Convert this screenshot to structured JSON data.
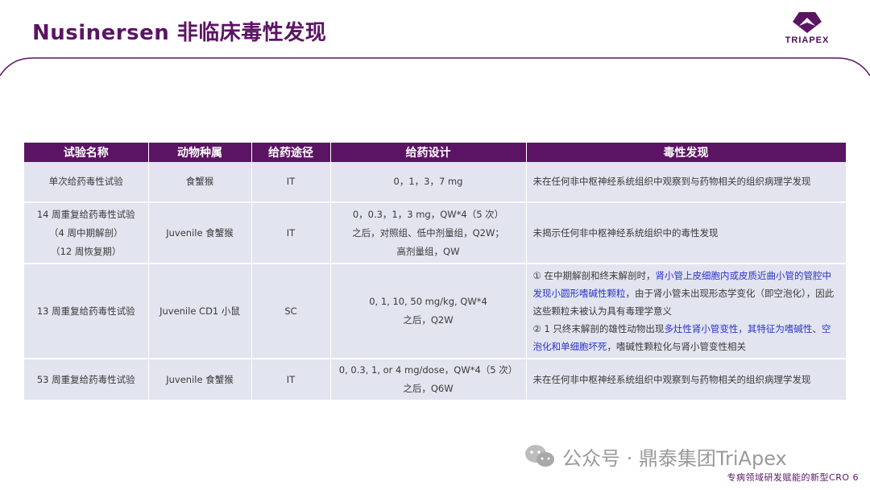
{
  "header": {
    "title": "Nusinersen 非临床毒性发现",
    "logo_text": "TRIAPEX"
  },
  "table": {
    "headers": [
      "试验名称",
      "动物种属",
      "给药途径",
      "给药设计",
      "毒性发现"
    ],
    "rows": [
      {
        "study": [
          "单次给药毒性试验"
        ],
        "species": "食蟹猴",
        "route": "IT",
        "design": [
          "0，1，3，7 mg"
        ],
        "finding": [
          {
            "t": "未在任何非中枢神经系统组织中观察到与药物相关的组织病理学发现"
          }
        ]
      },
      {
        "study": [
          "14 周重复给药毒性试验",
          "（4 周中期解剖）",
          "（12 周恢复期）"
        ],
        "species": "Juvenile 食蟹猴",
        "route": "IT",
        "design": [
          "0，0.3，1，3 mg，QW*4（5 次）",
          "之后，对照组、低中剂量组，Q2W；",
          "高剂量组，QW"
        ],
        "finding": [
          {
            "t": "未揭示任何非中枢神经系统组织中的毒性发现"
          }
        ]
      },
      {
        "study": [
          "13 周重复给药毒性试验"
        ],
        "species": "Juvenile CD1 小鼠",
        "route": "SC",
        "design": [
          "0, 1, 10, 50 mg/kg, QW*4",
          "之后，Q2W"
        ],
        "finding": [
          {
            "t": "① 在中期解剖和终末解剖时，"
          },
          {
            "t": "肾小管上皮细胞内或皮质近曲小管的管腔中发现小圆形嗜碱性颗粒",
            "hl": true
          },
          {
            "t": "，由于肾小管未出现形态学变化（即空泡化），因此这些颗粒未被认为具有毒理学意义",
            "br": true
          },
          {
            "t": "② 1 只终末解剖的雄性动物出现"
          },
          {
            "t": "多灶性肾小管变性，其特征为嗜碱性、空泡化和单细胞坏死",
            "hl": true
          },
          {
            "t": "，嗜碱性颗粒化与肾小管变性相关"
          }
        ]
      },
      {
        "study": [
          "53 周重复给药毒性试验"
        ],
        "species": "Juvenile 食蟹猴",
        "route": "IT",
        "design": [
          "0, 0.3, 1, or 4 mg/dose，QW*4（5 次）",
          "之后，Q6W"
        ],
        "finding": [
          {
            "t": "未在任何非中枢神经系统组织中观察到与药物相关的组织病理学发现"
          }
        ]
      }
    ]
  },
  "watermark": "公众号 · 鼎泰集团TriApex",
  "footer": "专病领域研发赋能的新型CRO  6",
  "colors": {
    "brand": "#5b1463",
    "row_bg": "#e2e4ef",
    "highlight": "#2b34c9"
  }
}
